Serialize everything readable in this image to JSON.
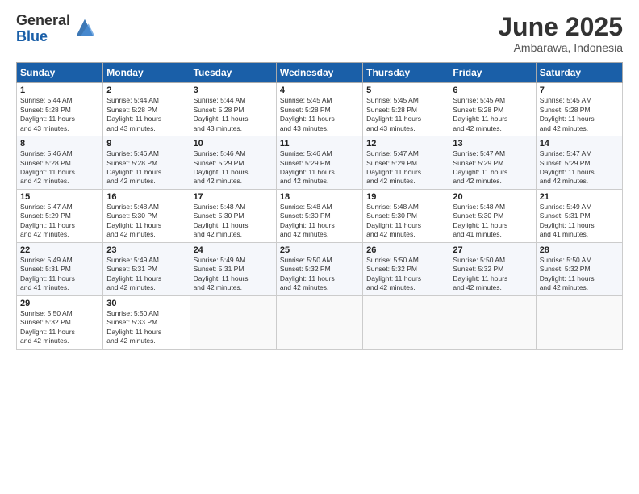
{
  "header": {
    "logo_general": "General",
    "logo_blue": "Blue",
    "month": "June 2025",
    "location": "Ambarawa, Indonesia"
  },
  "columns": [
    "Sunday",
    "Monday",
    "Tuesday",
    "Wednesday",
    "Thursday",
    "Friday",
    "Saturday"
  ],
  "weeks": [
    [
      {
        "day": "1",
        "info": "Sunrise: 5:44 AM\nSunset: 5:28 PM\nDaylight: 11 hours\nand 43 minutes."
      },
      {
        "day": "2",
        "info": "Sunrise: 5:44 AM\nSunset: 5:28 PM\nDaylight: 11 hours\nand 43 minutes."
      },
      {
        "day": "3",
        "info": "Sunrise: 5:44 AM\nSunset: 5:28 PM\nDaylight: 11 hours\nand 43 minutes."
      },
      {
        "day": "4",
        "info": "Sunrise: 5:45 AM\nSunset: 5:28 PM\nDaylight: 11 hours\nand 43 minutes."
      },
      {
        "day": "5",
        "info": "Sunrise: 5:45 AM\nSunset: 5:28 PM\nDaylight: 11 hours\nand 43 minutes."
      },
      {
        "day": "6",
        "info": "Sunrise: 5:45 AM\nSunset: 5:28 PM\nDaylight: 11 hours\nand 42 minutes."
      },
      {
        "day": "7",
        "info": "Sunrise: 5:45 AM\nSunset: 5:28 PM\nDaylight: 11 hours\nand 42 minutes."
      }
    ],
    [
      {
        "day": "8",
        "info": "Sunrise: 5:46 AM\nSunset: 5:28 PM\nDaylight: 11 hours\nand 42 minutes."
      },
      {
        "day": "9",
        "info": "Sunrise: 5:46 AM\nSunset: 5:28 PM\nDaylight: 11 hours\nand 42 minutes."
      },
      {
        "day": "10",
        "info": "Sunrise: 5:46 AM\nSunset: 5:29 PM\nDaylight: 11 hours\nand 42 minutes."
      },
      {
        "day": "11",
        "info": "Sunrise: 5:46 AM\nSunset: 5:29 PM\nDaylight: 11 hours\nand 42 minutes."
      },
      {
        "day": "12",
        "info": "Sunrise: 5:47 AM\nSunset: 5:29 PM\nDaylight: 11 hours\nand 42 minutes."
      },
      {
        "day": "13",
        "info": "Sunrise: 5:47 AM\nSunset: 5:29 PM\nDaylight: 11 hours\nand 42 minutes."
      },
      {
        "day": "14",
        "info": "Sunrise: 5:47 AM\nSunset: 5:29 PM\nDaylight: 11 hours\nand 42 minutes."
      }
    ],
    [
      {
        "day": "15",
        "info": "Sunrise: 5:47 AM\nSunset: 5:29 PM\nDaylight: 11 hours\nand 42 minutes."
      },
      {
        "day": "16",
        "info": "Sunrise: 5:48 AM\nSunset: 5:30 PM\nDaylight: 11 hours\nand 42 minutes."
      },
      {
        "day": "17",
        "info": "Sunrise: 5:48 AM\nSunset: 5:30 PM\nDaylight: 11 hours\nand 42 minutes."
      },
      {
        "day": "18",
        "info": "Sunrise: 5:48 AM\nSunset: 5:30 PM\nDaylight: 11 hours\nand 42 minutes."
      },
      {
        "day": "19",
        "info": "Sunrise: 5:48 AM\nSunset: 5:30 PM\nDaylight: 11 hours\nand 42 minutes."
      },
      {
        "day": "20",
        "info": "Sunrise: 5:48 AM\nSunset: 5:30 PM\nDaylight: 11 hours\nand 41 minutes."
      },
      {
        "day": "21",
        "info": "Sunrise: 5:49 AM\nSunset: 5:31 PM\nDaylight: 11 hours\nand 41 minutes."
      }
    ],
    [
      {
        "day": "22",
        "info": "Sunrise: 5:49 AM\nSunset: 5:31 PM\nDaylight: 11 hours\nand 41 minutes."
      },
      {
        "day": "23",
        "info": "Sunrise: 5:49 AM\nSunset: 5:31 PM\nDaylight: 11 hours\nand 42 minutes."
      },
      {
        "day": "24",
        "info": "Sunrise: 5:49 AM\nSunset: 5:31 PM\nDaylight: 11 hours\nand 42 minutes."
      },
      {
        "day": "25",
        "info": "Sunrise: 5:50 AM\nSunset: 5:32 PM\nDaylight: 11 hours\nand 42 minutes."
      },
      {
        "day": "26",
        "info": "Sunrise: 5:50 AM\nSunset: 5:32 PM\nDaylight: 11 hours\nand 42 minutes."
      },
      {
        "day": "27",
        "info": "Sunrise: 5:50 AM\nSunset: 5:32 PM\nDaylight: 11 hours\nand 42 minutes."
      },
      {
        "day": "28",
        "info": "Sunrise: 5:50 AM\nSunset: 5:32 PM\nDaylight: 11 hours\nand 42 minutes."
      }
    ],
    [
      {
        "day": "29",
        "info": "Sunrise: 5:50 AM\nSunset: 5:32 PM\nDaylight: 11 hours\nand 42 minutes."
      },
      {
        "day": "30",
        "info": "Sunrise: 5:50 AM\nSunset: 5:33 PM\nDaylight: 11 hours\nand 42 minutes."
      },
      {
        "day": "",
        "info": ""
      },
      {
        "day": "",
        "info": ""
      },
      {
        "day": "",
        "info": ""
      },
      {
        "day": "",
        "info": ""
      },
      {
        "day": "",
        "info": ""
      }
    ]
  ]
}
